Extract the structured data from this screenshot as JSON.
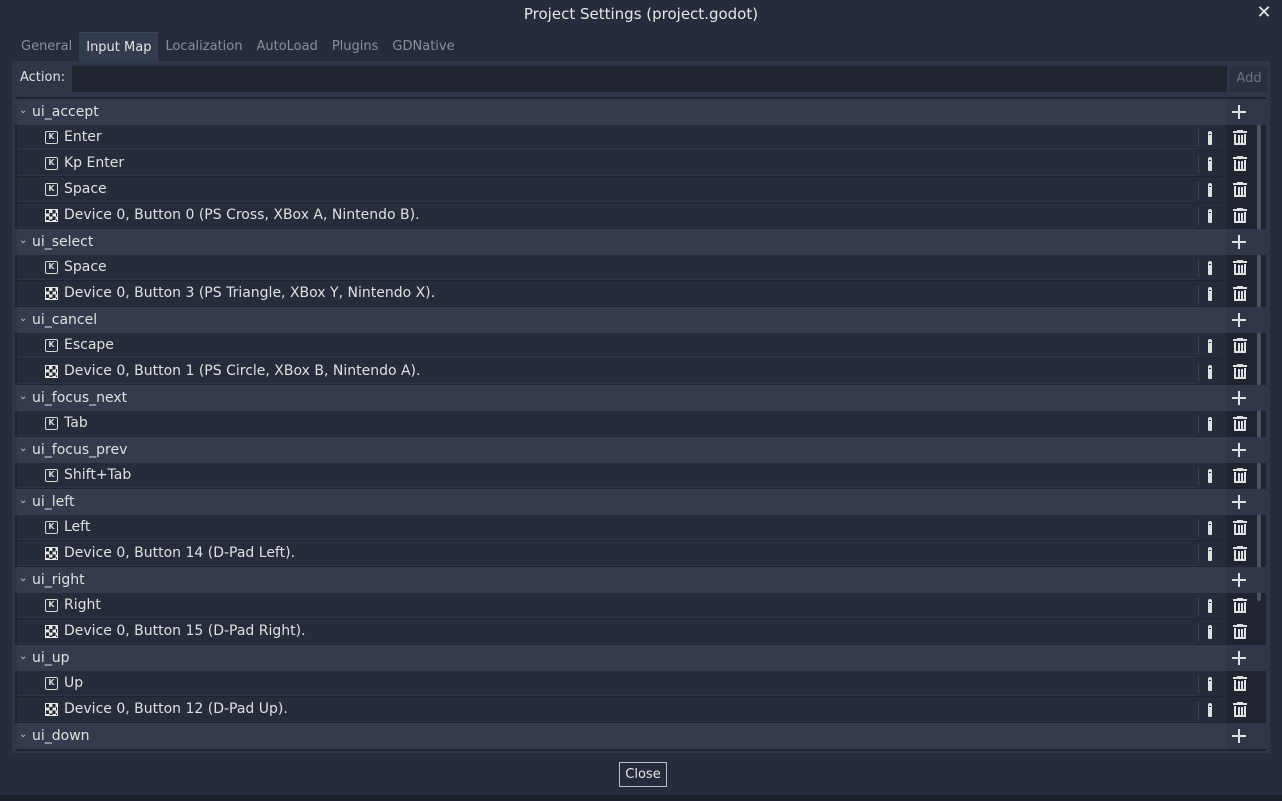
{
  "window": {
    "title": "Project Settings (project.godot)",
    "close_glyph": "✕"
  },
  "tabs": [
    {
      "label": "General"
    },
    {
      "label": "Input Map",
      "active": true
    },
    {
      "label": "Localization"
    },
    {
      "label": "AutoLoad"
    },
    {
      "label": "Plugins"
    },
    {
      "label": "GDNative"
    }
  ],
  "action_bar": {
    "label": "Action:",
    "value": "",
    "placeholder": "",
    "add_label": "Add"
  },
  "actions": [
    {
      "name": "ui_accept",
      "events": [
        {
          "type": "key",
          "label": "Enter"
        },
        {
          "type": "key",
          "label": "Kp Enter"
        },
        {
          "type": "key",
          "label": "Space"
        },
        {
          "type": "joypad",
          "label": "Device 0, Button 0 (PS Cross, XBox A, Nintendo B)."
        }
      ]
    },
    {
      "name": "ui_select",
      "events": [
        {
          "type": "key",
          "label": "Space"
        },
        {
          "type": "joypad",
          "label": "Device 0, Button 3 (PS Triangle, XBox Y, Nintendo X)."
        }
      ]
    },
    {
      "name": "ui_cancel",
      "events": [
        {
          "type": "key",
          "label": "Escape"
        },
        {
          "type": "joypad",
          "label": "Device 0, Button 1 (PS Circle, XBox B, Nintendo A)."
        }
      ]
    },
    {
      "name": "ui_focus_next",
      "events": [
        {
          "type": "key",
          "label": "Tab"
        }
      ]
    },
    {
      "name": "ui_focus_prev",
      "events": [
        {
          "type": "key",
          "label": "Shift+Tab"
        }
      ]
    },
    {
      "name": "ui_left",
      "events": [
        {
          "type": "key",
          "label": "Left"
        },
        {
          "type": "joypad",
          "label": "Device 0, Button 14 (D-Pad Left)."
        }
      ]
    },
    {
      "name": "ui_right",
      "events": [
        {
          "type": "key",
          "label": "Right"
        },
        {
          "type": "joypad",
          "label": "Device 0, Button 15 (D-Pad Right)."
        }
      ]
    },
    {
      "name": "ui_up",
      "events": [
        {
          "type": "key",
          "label": "Up"
        },
        {
          "type": "joypad",
          "label": "Device 0, Button 12 (D-Pad Up)."
        }
      ]
    },
    {
      "name": "ui_down",
      "events": []
    }
  ],
  "icons": {
    "expand": "chevron-down-icon",
    "add_event": "plus-icon",
    "edit_event": "edit-icon",
    "remove_event": "trash-icon",
    "key_event": "keyboard-icon",
    "joypad_event": "joypad-icon"
  },
  "footer": {
    "close_label": "Close"
  },
  "colors": {
    "background": "#262c3b",
    "panel": "#2f3647",
    "tree": "#1f2430",
    "text": "#e0e0e0",
    "dim_text": "#8a8e99"
  }
}
